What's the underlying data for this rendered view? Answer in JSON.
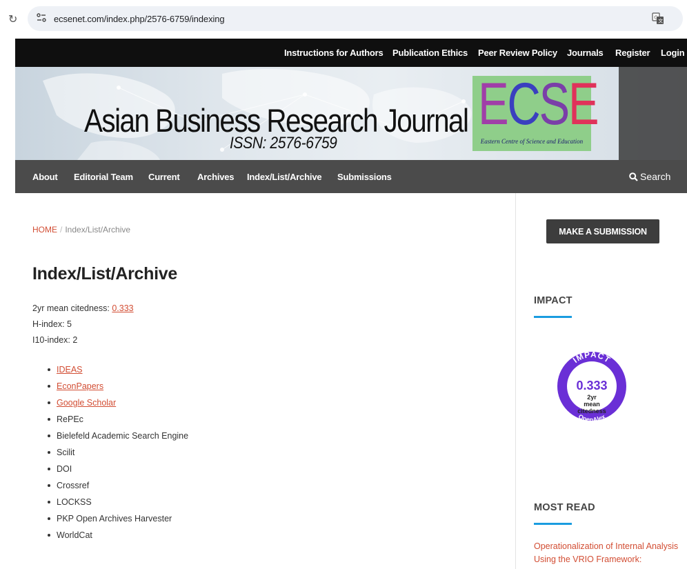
{
  "browser": {
    "url": "ecsenet.com/index.php/2576-6759/indexing"
  },
  "top_nav": [
    {
      "label": "Instructions for Authors"
    },
    {
      "label": "Publication Ethics"
    },
    {
      "label": "Peer Review Policy"
    },
    {
      "label": "Journals"
    },
    {
      "label": "Register"
    },
    {
      "label": "Login"
    }
  ],
  "banner": {
    "title": "Asian Business Research Journal",
    "issn": "ISSN: 2576-6759",
    "logo_letters": "ECSE",
    "logo_subtitle": "Eastern Centre of Science and Education",
    "logo_colors": {
      "E1": "#a03ea8",
      "C": "#3a3fbf",
      "S": "#7a3fa8",
      "E2": "#e0325a",
      "background": "#8fce8a"
    }
  },
  "main_nav": [
    {
      "label": "About"
    },
    {
      "label": "Editorial Team"
    },
    {
      "label": "Current"
    },
    {
      "label": "Archives"
    },
    {
      "label": "Index/List/Archive"
    },
    {
      "label": "Submissions"
    }
  ],
  "search": {
    "label": "Search",
    "icon": "search-icon"
  },
  "breadcrumb": {
    "home": "HOME",
    "separator": "/",
    "current": "Index/List/Archive"
  },
  "page_title": "Index/List/Archive",
  "stats": {
    "citedness_label": "2yr mean citedness: ",
    "citedness_value": "0.333",
    "h_index": "H-index: 5",
    "i10_index": "I10-index: 2"
  },
  "index_list": [
    {
      "label": "IDEAS",
      "link": true
    },
    {
      "label": "EconPapers",
      "link": true
    },
    {
      "label": "Google Scholar",
      "link": true
    },
    {
      "label": "RePEc",
      "link": false
    },
    {
      "label": "Bielefeld Academic Search Engine",
      "link": false
    },
    {
      "label": "Scilit",
      "link": false
    },
    {
      "label": "DOI",
      "link": false
    },
    {
      "label": "Crossref",
      "link": false
    },
    {
      "label": "LOCKSS",
      "link": false
    },
    {
      "label": "PKP Open Archives Harvester",
      "link": false
    },
    {
      "label": "WorldCat",
      "link": false
    }
  ],
  "sidebar": {
    "submit_button": "MAKE A SUBMISSION",
    "impact_heading": "IMPACT",
    "badge": {
      "arc_text": "IMPACT",
      "value": "0.333",
      "line1": "2yr",
      "line2": "mean",
      "line3": "citedness",
      "footer": "OpenAlex",
      "ring_color": "#6a2fd6"
    },
    "most_read_heading": "MOST READ",
    "most_read": [
      "Operationalization of Internal Analysis",
      "Using the VRIO Framework:"
    ]
  },
  "colors": {
    "accent_link": "#d24d33",
    "top_nav_bg": "#0f0f0f",
    "main_nav_bg": "#4b4b4b",
    "heading_underline": "#1a9ce0"
  }
}
